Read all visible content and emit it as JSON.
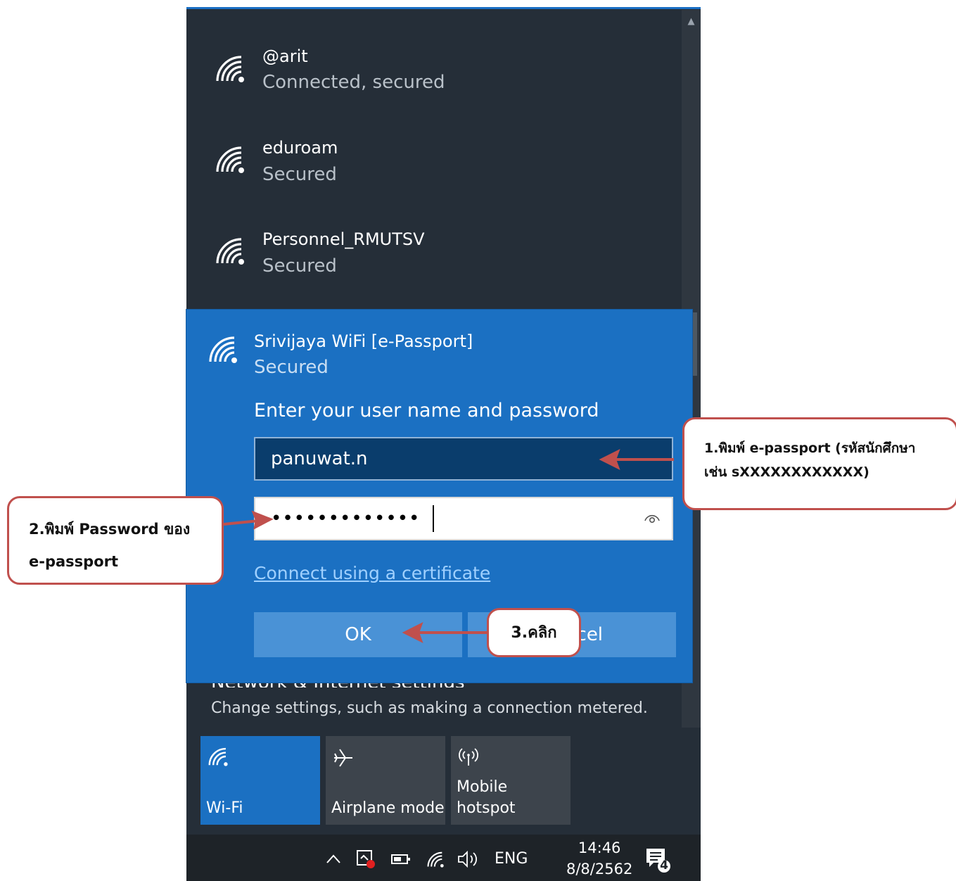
{
  "networks": [
    {
      "name": "@arit",
      "status": "Connected, secured"
    },
    {
      "name": "eduroam",
      "status": "Secured"
    },
    {
      "name": "Personnel_RMUTSV",
      "status": "Secured"
    }
  ],
  "expanded": {
    "name": "Srivijaya WiFi [e-Passport]",
    "status": "Secured",
    "prompt": "Enter your user name and password",
    "username_value": "panuwat.n",
    "password_mask": "•••••••••••••",
    "cert_link": "Connect using a certificate",
    "ok_label": "OK",
    "cancel_label": "Cancel"
  },
  "settings": {
    "title": "Network & Internet settings",
    "subtitle": "Change settings, such as making a connection metered."
  },
  "quick_actions": [
    {
      "label": "Wi-Fi",
      "icon": "wifi-icon",
      "active": true
    },
    {
      "label": "Airplane mode",
      "icon": "airplane-icon",
      "active": false
    },
    {
      "label": "Mobile\nhotspot",
      "icon": "hotspot-icon",
      "active": false
    }
  ],
  "taskbar": {
    "language": "ENG",
    "time": "14:46",
    "date": "8/8/2562",
    "notification_count": "4"
  },
  "annotations": {
    "step1_line1": "1.พิมพ์ e-passport (รหัสนักศึกษา",
    "step1_line2": "เช่น sXXXXXXXXXXXX)",
    "step2_line1": "2.พิมพ์ Password ของ",
    "step2_line2": "e-passport",
    "step3": "3.คลิก",
    "color": "#c0504d"
  },
  "colors": {
    "panel_bg": "#252e38",
    "accent": "#1b70c2",
    "taskbar_bg": "#1e2328"
  }
}
